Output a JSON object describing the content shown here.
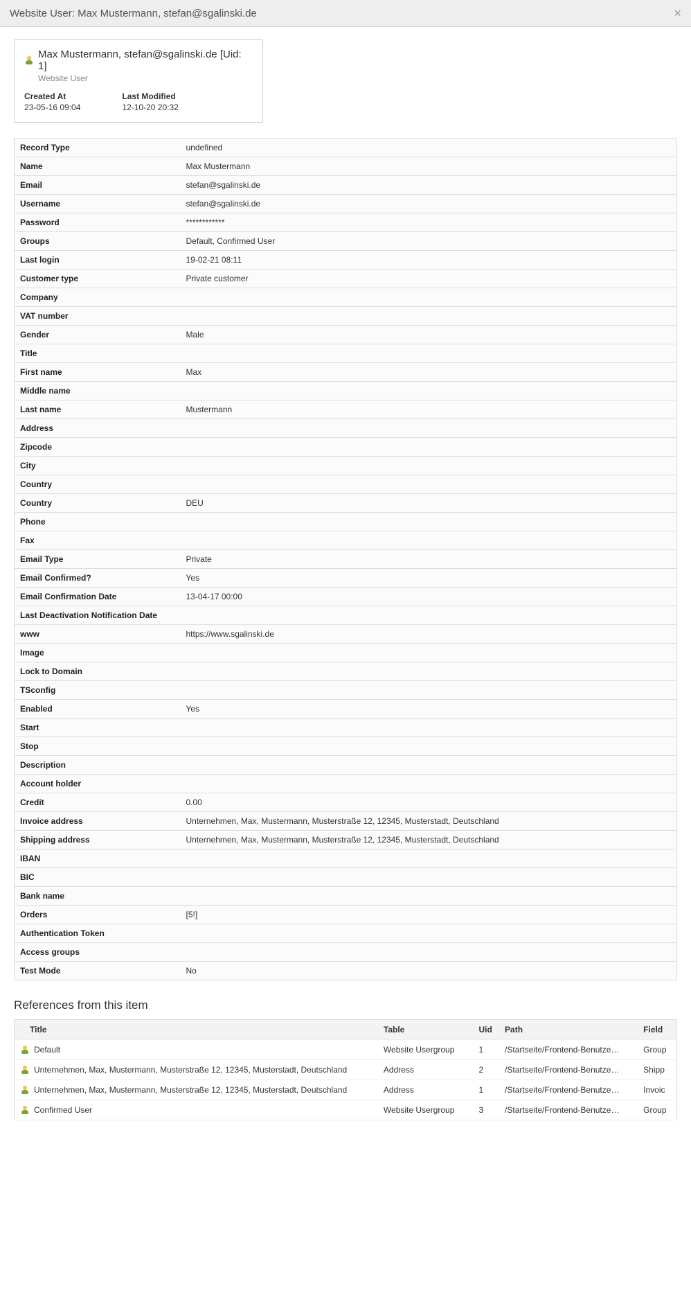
{
  "header": {
    "title": "Website User: Max Mustermann, stefan@sgalinski.de"
  },
  "card": {
    "title": "Max Mustermann, stefan@sgalinski.de [Uid: 1]",
    "subtitle": "Website User",
    "createdLabel": "Created At",
    "createdValue": "23-05-16 09:04",
    "modifiedLabel": "Last Modified",
    "modifiedValue": "12-10-20 20:32"
  },
  "rows": [
    {
      "key": "Record Type",
      "val": "undefined"
    },
    {
      "key": "Name",
      "val": "Max Mustermann"
    },
    {
      "key": "Email",
      "val": "stefan@sgalinski.de"
    },
    {
      "key": "Username",
      "val": "stefan@sgalinski.de"
    },
    {
      "key": "Password",
      "val": "************"
    },
    {
      "key": "Groups",
      "val": "Default, Confirmed User"
    },
    {
      "key": "Last login",
      "val": "19-02-21 08:11"
    },
    {
      "key": "Customer type",
      "val": "Private customer"
    },
    {
      "key": "Company",
      "val": ""
    },
    {
      "key": "VAT number",
      "val": ""
    },
    {
      "key": "Gender",
      "val": "Male"
    },
    {
      "key": "Title",
      "val": ""
    },
    {
      "key": "First name",
      "val": "Max"
    },
    {
      "key": "Middle name",
      "val": ""
    },
    {
      "key": "Last name",
      "val": "Mustermann"
    },
    {
      "key": "Address",
      "val": ""
    },
    {
      "key": "Zipcode",
      "val": ""
    },
    {
      "key": "City",
      "val": ""
    },
    {
      "key": "Country",
      "val": ""
    },
    {
      "key": "Country",
      "val": "DEU"
    },
    {
      "key": "Phone",
      "val": ""
    },
    {
      "key": "Fax",
      "val": ""
    },
    {
      "key": "Email Type",
      "val": "Private"
    },
    {
      "key": "Email Confirmed?",
      "val": "Yes"
    },
    {
      "key": "Email Confirmation Date",
      "val": "13-04-17 00:00"
    },
    {
      "key": "Last Deactivation Notification Date",
      "val": ""
    },
    {
      "key": "www",
      "val": "https://www.sgalinski.de"
    },
    {
      "key": "Image",
      "val": ""
    },
    {
      "key": "Lock to Domain",
      "val": ""
    },
    {
      "key": "TSconfig",
      "val": ""
    },
    {
      "key": "Enabled",
      "val": "Yes"
    },
    {
      "key": "Start",
      "val": ""
    },
    {
      "key": "Stop",
      "val": ""
    },
    {
      "key": "Description",
      "val": ""
    },
    {
      "key": "Account holder",
      "val": ""
    },
    {
      "key": "Credit",
      "val": "0.00"
    },
    {
      "key": "Invoice address",
      "val": "Unternehmen, Max, Mustermann, Musterstraße 12, 12345, Musterstadt, Deutschland"
    },
    {
      "key": "Shipping address",
      "val": "Unternehmen, Max, Mustermann, Musterstraße 12, 12345, Musterstadt, Deutschland"
    },
    {
      "key": "IBAN",
      "val": ""
    },
    {
      "key": "BIC",
      "val": ""
    },
    {
      "key": "Bank name",
      "val": ""
    },
    {
      "key": "Orders",
      "val": "[5!]"
    },
    {
      "key": "Authentication Token",
      "val": ""
    },
    {
      "key": "Access groups",
      "val": ""
    },
    {
      "key": "Test Mode",
      "val": "No"
    }
  ],
  "references": {
    "heading": "References from this item",
    "columns": {
      "title": "Title",
      "table": "Table",
      "uid": "Uid",
      "path": "Path",
      "field": "Field"
    },
    "items": [
      {
        "title": "Default",
        "table": "Website Usergroup",
        "uid": "1",
        "path": "/Startseite/Frontend-Benutze…",
        "field": "Group"
      },
      {
        "title": "Unternehmen, Max, Mustermann, Musterstraße 12, 12345, Musterstadt, Deutschland",
        "table": "Address",
        "uid": "2",
        "path": "/Startseite/Frontend-Benutze…",
        "field": "Shipp"
      },
      {
        "title": "Unternehmen, Max, Mustermann, Musterstraße 12, 12345, Musterstadt, Deutschland",
        "table": "Address",
        "uid": "1",
        "path": "/Startseite/Frontend-Benutze…",
        "field": "Invoic"
      },
      {
        "title": "Confirmed User",
        "table": "Website Usergroup",
        "uid": "3",
        "path": "/Startseite/Frontend-Benutze…",
        "field": "Group"
      }
    ]
  }
}
